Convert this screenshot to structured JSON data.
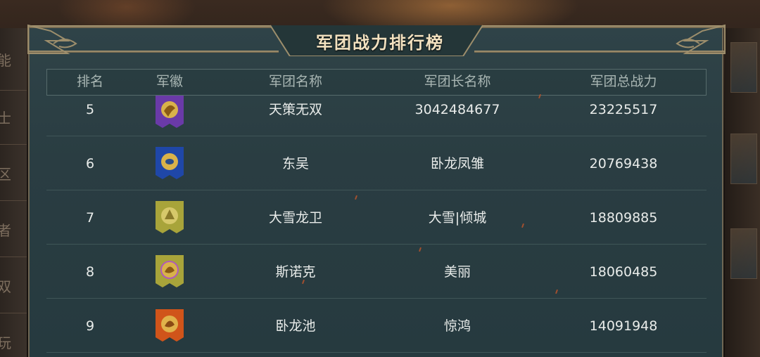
{
  "leaderboard": {
    "title": "军团战力排行榜",
    "columns": {
      "rank": "排名",
      "badge": "军徽",
      "team_name": "军团名称",
      "leader_name": "军团长名称",
      "total_power": "军团总战力"
    },
    "rows": [
      {
        "rank": "5",
        "team_name": "天策无双",
        "leader_name": "3042484677",
        "total_power": "23225517",
        "badge_color": "#6a3aa8",
        "badge_animal": "eagle-emblem-icon"
      },
      {
        "rank": "6",
        "team_name": "东吴",
        "leader_name": "卧龙凤雏",
        "total_power": "20769438",
        "badge_color": "#1f47a8",
        "badge_animal": "dragon-emblem-icon"
      },
      {
        "rank": "7",
        "team_name": "大雪龙卫",
        "leader_name": "大雪|倾城",
        "total_power": "18809885",
        "badge_color": "#a8a43a",
        "badge_animal": "rider-emblem-icon"
      },
      {
        "rank": "8",
        "team_name": "斯诺克",
        "leader_name": "美丽",
        "total_power": "18060485",
        "badge_color": "#a8a43a",
        "badge_animal": "tiger-emblem-icon"
      },
      {
        "rank": "9",
        "team_name": "卧龙池",
        "leader_name": "惊鸿",
        "total_power": "14091948",
        "badge_color": "#d0541a",
        "badge_animal": "tiger-emblem-icon"
      }
    ]
  },
  "side_left_chars": [
    "能",
    "士",
    "区",
    "者",
    "双",
    "玩"
  ],
  "colors": {
    "panel_bg": "#2a3d42",
    "title_text": "#f3e2c0",
    "header_text": "#a9b6b3",
    "cell_text": "#e9ecea",
    "frame_gold": "#8c7f62"
  }
}
